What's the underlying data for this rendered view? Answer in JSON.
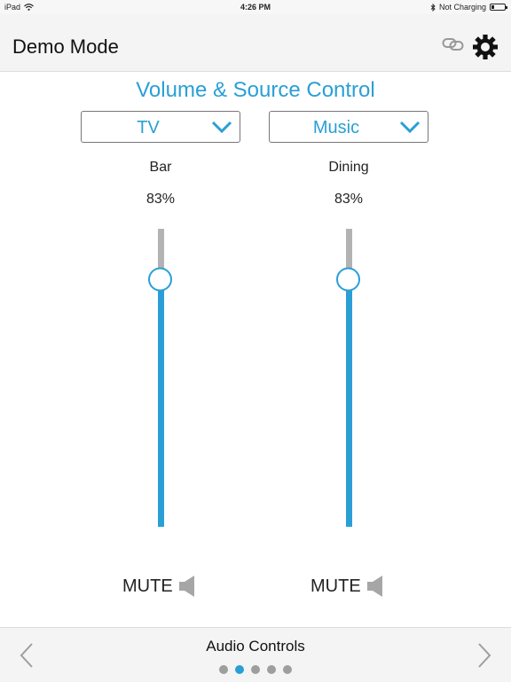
{
  "status_bar": {
    "device": "iPad",
    "time": "4:26 PM",
    "battery_text": "Not Charging"
  },
  "header": {
    "title": "Demo Mode",
    "icons": [
      "link-icon",
      "gear-icon"
    ]
  },
  "main": {
    "title": "Volume & Source Control",
    "zones": [
      {
        "source": "TV",
        "name": "Bar",
        "volume_text": "83%",
        "volume": 0.83,
        "mute_label": "MUTE"
      },
      {
        "source": "Music",
        "name": "Dining",
        "volume_text": "83%",
        "volume": 0.83,
        "mute_label": "MUTE"
      }
    ]
  },
  "footer": {
    "title": "Audio Controls",
    "page_count": 5,
    "active_page": 2
  },
  "colors": {
    "accent": "#2a9fd6",
    "track": "#b3b3b3",
    "header_bg": "#f4f4f4"
  }
}
